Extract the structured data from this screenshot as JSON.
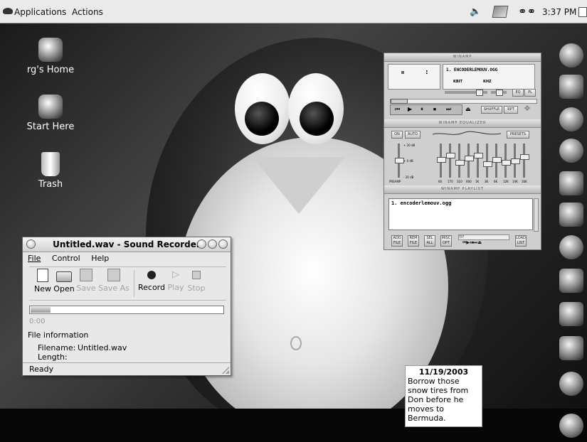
{
  "top_panel": {
    "menu_applications": "Applications",
    "menu_actions": "Actions",
    "clock": "3:37 PM"
  },
  "desktop_icons": [
    {
      "label": "rg's Home",
      "icon": "penguin-home-icon"
    },
    {
      "label": "Start Here",
      "icon": "start-here-icon"
    },
    {
      "label": "Trash",
      "icon": "trash-icon"
    }
  ],
  "winamp": {
    "main_title": "WINAMP",
    "track": "1. ENCODERLEMOUV.OGG",
    "kbit": "KBIT",
    "khz": "KHZ",
    "eq_btn": "EQ",
    "pl_btn": "PL",
    "shuffle": "SHUFFLE",
    "repeat": "RPT",
    "equalizer_title": "WINAMP EQUALIZER",
    "eq_on": "ON",
    "eq_auto": "AUTO",
    "eq_presets": "PRESETS",
    "db_plus": "+ 20 dB",
    "db_zero": "+ 0 dB",
    "db_minus": "- 20 dB",
    "preamp": "PREAMP",
    "bands": [
      "60",
      "170",
      "310",
      "600",
      "1K",
      "3K",
      "6K",
      "12K",
      "14K",
      "16K"
    ],
    "band_levels": [
      0.45,
      0.3,
      0.55,
      0.4,
      0.3,
      0.6,
      0.45,
      0.55,
      0.5,
      0.35
    ],
    "playlist_title": "WINAMP PLAYLIST",
    "playlist_item": "1. encoderlemouv.ogg",
    "pl_add": "ADD FILE",
    "pl_rem": "REM FILE",
    "pl_sel": "SEL ALL",
    "pl_misc": "MISC OPT",
    "pl_load": "LOAD LIST",
    "pl_count": "?/?"
  },
  "recorder": {
    "title": "Untitled.wav - Sound Recorder",
    "menu": [
      "File",
      "Control",
      "Help"
    ],
    "toolbar": [
      {
        "label": "New",
        "enabled": true
      },
      {
        "label": "Open",
        "enabled": true
      },
      {
        "label": "Save",
        "enabled": false
      },
      {
        "label": "Save As",
        "enabled": false
      },
      {
        "label": "Record",
        "enabled": true
      },
      {
        "label": "Play",
        "enabled": false
      },
      {
        "label": "Stop",
        "enabled": false
      }
    ],
    "time": "0:00",
    "file_info_heading": "File information",
    "filename_label": "Filename:",
    "filename_value": "Untitled.wav",
    "length_label": "Length:",
    "length_value": "",
    "status": "Ready"
  },
  "sticky_note": {
    "date": "11/19/2003",
    "text": "Borrow those snow tires from Don before he moves to Bermuda."
  }
}
